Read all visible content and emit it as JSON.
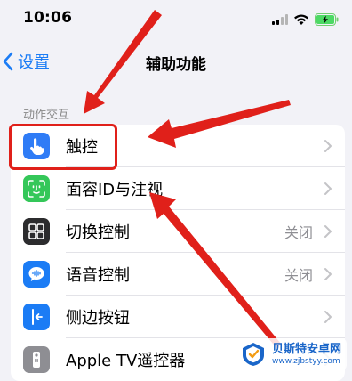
{
  "status_bar": {
    "time": "10:06"
  },
  "nav": {
    "back_label": "设置",
    "title": "辅助功能"
  },
  "section": {
    "header": "动作交互"
  },
  "rows": [
    {
      "label": "触控",
      "value": ""
    },
    {
      "label": "面容ID与注视",
      "value": ""
    },
    {
      "label": "切换控制",
      "value": "关闭"
    },
    {
      "label": "语音控制",
      "value": "关闭"
    },
    {
      "label": "侧边按钮",
      "value": ""
    },
    {
      "label": "Apple TV遥控器",
      "value": ""
    }
  ],
  "icons": {
    "touch": "hand-tap-icon",
    "face_id": "face-id-icon",
    "switch_control": "grid-icon",
    "voice_control": "speech-bubble-icon",
    "side_button": "side-button-icon",
    "apple_tv": "remote-icon"
  },
  "colors": {
    "accent": "#1b7cf5",
    "annotation": "#e0201a",
    "touch_icon_bg": "#2f7cf6",
    "face_id_icon_bg": "#34c759",
    "switch_icon_bg": "#2c2c2e",
    "voice_icon_bg": "#1b7cf5",
    "side_icon_bg": "#1b7cf5",
    "tv_icon_bg": "#8e8e93"
  },
  "watermark": {
    "title": "贝斯特安卓网",
    "url": "www.zjbstyy.com"
  }
}
